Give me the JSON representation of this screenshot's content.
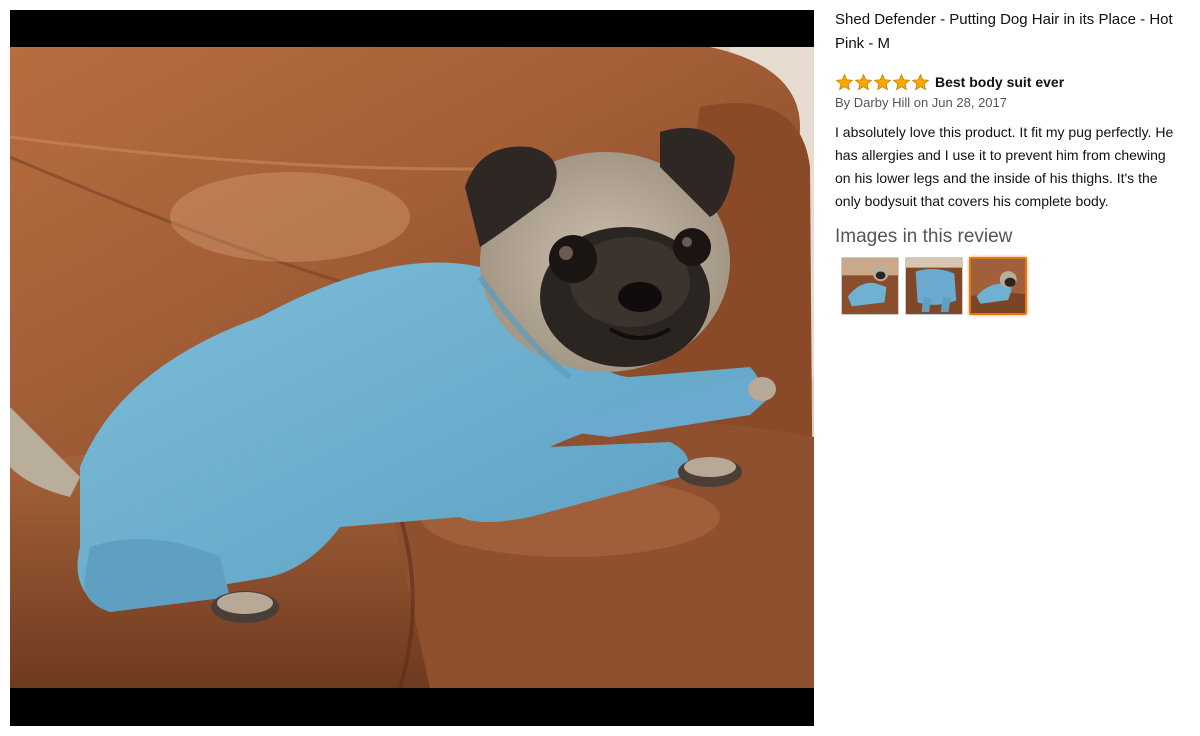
{
  "product": {
    "title": "Shed Defender - Putting Dog Hair in its Place - Hot Pink - M"
  },
  "review": {
    "rating": 5,
    "max_rating": 5,
    "title": "Best body suit ever",
    "byline": "By Darby Hill on Jun 28, 2017",
    "body": "I absolutely love this product. It fit my pug perfectly. He has allergies and I use it to prevent him from chewing on his lower legs and the inside of his thighs. It's the only bodysuit that covers his complete body."
  },
  "images": {
    "heading": "Images in this review",
    "thumbnails": [
      {
        "selected": false
      },
      {
        "selected": false
      },
      {
        "selected": true
      }
    ]
  },
  "colors": {
    "star": "#f6a800",
    "selected_border": "#e47911",
    "suit": "#6fb1d0",
    "couch": "#9a5a34"
  }
}
